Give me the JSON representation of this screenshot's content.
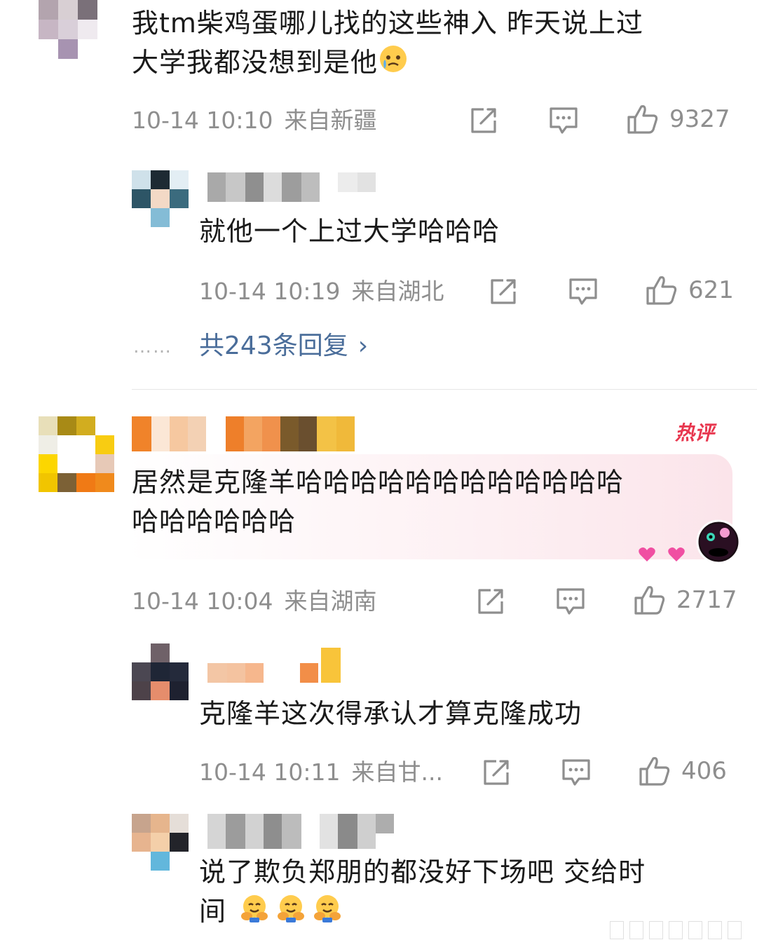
{
  "comments": [
    {
      "text_line1": "我tm柴鸡蛋哪儿找的这些神入 昨天说上过",
      "text_line2": "大学我都没想到是他",
      "emoji": "crying-face",
      "time": "10-14 10:10",
      "location": "来自新疆",
      "likes": "9327",
      "reply": {
        "text": "就他一个上过大学哈哈哈",
        "time": "10-14 10:19",
        "location": "来自湖北",
        "likes": "621"
      },
      "more_replies": "共243条回复",
      "more_dots": "……"
    },
    {
      "hot_badge": "热评",
      "text_line1": "居然是克隆羊哈哈哈哈哈哈哈哈哈哈哈哈",
      "text_line2": "哈哈哈哈哈哈",
      "time": "10-14 10:04",
      "location": "来自湖南",
      "likes": "2717",
      "replies": [
        {
          "text": "克隆羊这次得承认才算克隆成功",
          "time": "10-14 10:11",
          "location": "来自甘...",
          "likes": "406"
        },
        {
          "text_line1": "说了欺负郑朋的都没好下场吧 交给时",
          "text_line2": "间",
          "emoji": "hugging-face"
        }
      ]
    }
  ],
  "icons": {
    "share": "share-icon",
    "comment": "comment-icon",
    "like": "like-icon",
    "heart": "heart-icon"
  },
  "colors": {
    "link": "#4a6d9a",
    "hot_badge": "#e8374f",
    "meta": "#8e8e8e"
  }
}
